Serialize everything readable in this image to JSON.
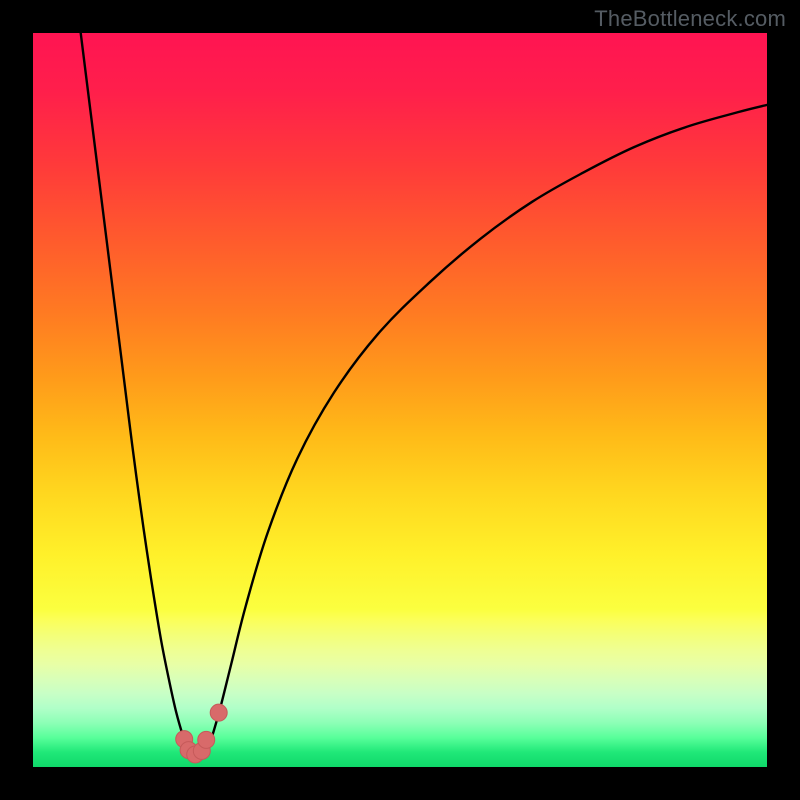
{
  "watermark": "TheBottleneck.com",
  "colors": {
    "frame": "#000000",
    "curve": "#000000",
    "marker_fill": "#d86a6a",
    "marker_stroke": "#c65a5a"
  },
  "chart_data": {
    "type": "line",
    "title": "",
    "xlabel": "",
    "ylabel": "",
    "xlim": [
      0,
      100
    ],
    "ylim": [
      0,
      100
    ],
    "grid": false,
    "series": [
      {
        "name": "left-branch",
        "x": [
          6.5,
          7.5,
          8.5,
          9.5,
          10.5,
          11.5,
          12.5,
          13.5,
          14.5,
          15.5,
          16.5,
          17.5,
          18.5,
          19.5,
          20.5,
          21.0,
          21.5
        ],
        "y": [
          100,
          92,
          84,
          76,
          68,
          60,
          52,
          44,
          36.5,
          29.5,
          23,
          17,
          12,
          7.5,
          4,
          2.7,
          2.2
        ]
      },
      {
        "name": "right-branch",
        "x": [
          23.5,
          24,
          24.5,
          25.5,
          27,
          29,
          32,
          36,
          41,
          47,
          54,
          61,
          68,
          75,
          82,
          89,
          96,
          100
        ],
        "y": [
          2.3,
          3,
          4.5,
          8,
          14,
          22,
          32,
          42,
          51,
          59,
          66,
          72,
          77,
          81,
          84.5,
          87.2,
          89.2,
          90.2
        ]
      }
    ],
    "markers": [
      {
        "label": "min-left-1",
        "x": 20.6,
        "y": 3.8
      },
      {
        "label": "min-left-2",
        "x": 21.2,
        "y": 2.3
      },
      {
        "label": "min-left-3",
        "x": 22.1,
        "y": 1.7
      },
      {
        "label": "min-right-1",
        "x": 23.0,
        "y": 2.2
      },
      {
        "label": "min-right-2",
        "x": 23.6,
        "y": 3.7
      },
      {
        "label": "iso-right",
        "x": 25.3,
        "y": 7.4
      }
    ]
  }
}
